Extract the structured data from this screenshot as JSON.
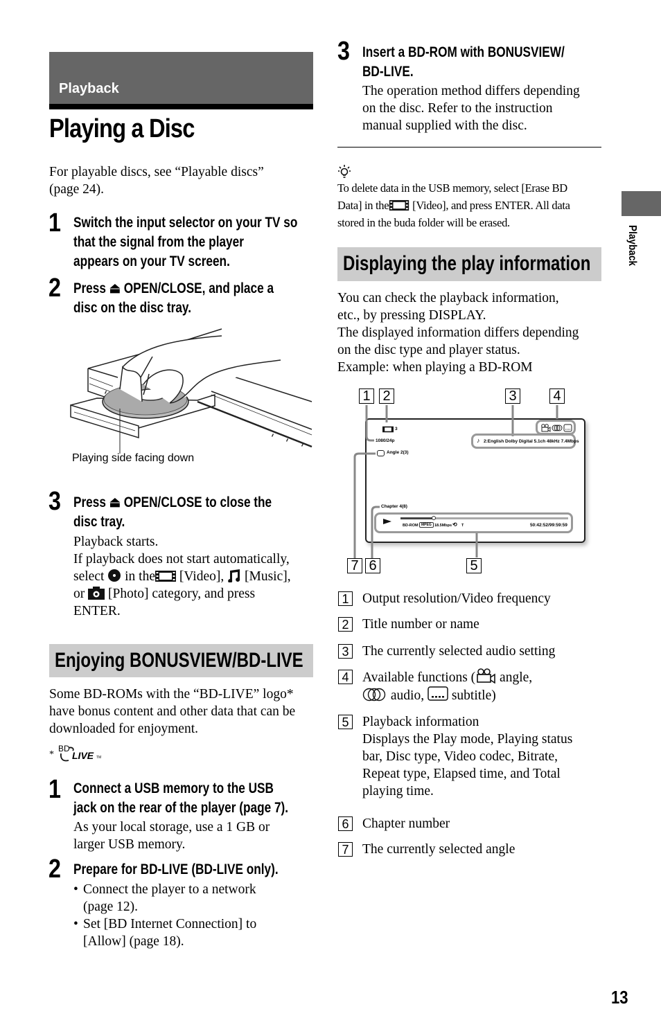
{
  "section_banner": "Playback",
  "page_title": "Playing a Disc",
  "intro": [
    "For playable discs, see “Playable discs”",
    "(page 24)."
  ],
  "steps_a": [
    {
      "num": "1",
      "lines": [
        "Switch the input selector on your TV so",
        "that the signal from the player",
        "appears on your TV screen."
      ]
    },
    {
      "num": "2",
      "lines": [
        "Press ⏏ OPEN/CLOSE, and place a",
        "disc on the disc tray."
      ]
    },
    {
      "num": "3",
      "lines": [
        "Press ⏏ OPEN/CLOSE to close the",
        "disc tray."
      ],
      "body": {
        "l1": "Playback starts.",
        "l2": "If playback does not start automatically,",
        "l3_a": "select",
        "l3_b": "in the",
        "l3_c": "[Video],",
        "l3_d": "[Music],",
        "l4_a": "or",
        "l4_b": "[Photo] category, and press",
        "l5": "ENTER."
      }
    }
  ],
  "illustration": {
    "caption": "Playing side facing down"
  },
  "bonus_section": {
    "heading": "Enjoying BONUSVIEW/BD-LIVE",
    "body": [
      "Some BD-ROMs with the “BD-LIVE” logo*",
      "have bonus content and other data that can be",
      "downloaded for enjoyment."
    ],
    "footnote_mark": "*",
    "logo_bd": "BD",
    "logo_live": "LIVE",
    "logo_tm": "TM",
    "steps": [
      {
        "num": "1",
        "lines": [
          "Connect a USB memory to the USB",
          "jack on the rear of the player (page 7)."
        ],
        "body": [
          "As your local storage, use a 1 GB or",
          "larger USB memory."
        ]
      },
      {
        "num": "2",
        "lines": [
          "Prepare for BD-LIVE (BD-LIVE only)."
        ],
        "bullets": [
          [
            "Connect the player to a network",
            "(page 12)."
          ],
          [
            "Set [BD Internet Connection] to",
            "[Allow] (page 18)."
          ]
        ]
      },
      {
        "num": "3",
        "lines": [
          "Insert a BD-ROM with BONUSVIEW/",
          "BD-LIVE."
        ],
        "body": [
          "The operation method differs depending",
          "on the disc. Refer to the instruction",
          "manual supplied with the disc."
        ]
      }
    ]
  },
  "tip": {
    "l1": "To delete data in the USB memory, select [Erase BD",
    "l2_a": "Data] in the",
    "l2_b": "[Video], and press ENTER. All data",
    "l3": "stored in the buda folder will be erased."
  },
  "play_info_section": {
    "heading": "Displaying the play information",
    "body": [
      "You can check the playback information,",
      "etc., by pressing DISPLAY.",
      "The displayed information differs depending",
      "on the disc type and player status.",
      "Example: when playing a BD-ROM"
    ]
  },
  "screen": {
    "callouts": [
      "1",
      "2",
      "3",
      "4",
      "5",
      "6",
      "7"
    ],
    "title_number": "3",
    "resolution": "1080/24p",
    "audio": "2:English  Dolby Digital 5.1ch 48kHz   7.4Mbps",
    "angle_label": "Angle",
    "angle_value": "2(3)",
    "chapter": "Chapter 4(8)",
    "disc_type": "BD-ROM",
    "codec": "MPEG",
    "bitrate": "18.5Mbps",
    "repeat": "T",
    "time": "50:42:52/99:59:59",
    "progress_fraction": 0.2
  },
  "legend": [
    {
      "num": "1",
      "text": "Output resolution/Video frequency"
    },
    {
      "num": "2",
      "text": "Title number or name"
    },
    {
      "num": "3",
      "text": "The currently selected audio setting"
    },
    {
      "num": "4",
      "text_a": "Available functions (",
      "text_b": "angle,",
      "text_c": "audio,",
      "text_d": "subtitle)"
    },
    {
      "num": "5",
      "lines": [
        "Playback information",
        "Displays the Play mode, Playing status",
        "bar, Disc type, Video codec, Bitrate,",
        "Repeat type, Elapsed time, and Total",
        "playing time."
      ]
    },
    {
      "num": "6",
      "text": "Chapter number"
    },
    {
      "num": "7",
      "text": "The currently selected angle"
    }
  ],
  "side_tab_label": "Playback",
  "page_number": "13"
}
